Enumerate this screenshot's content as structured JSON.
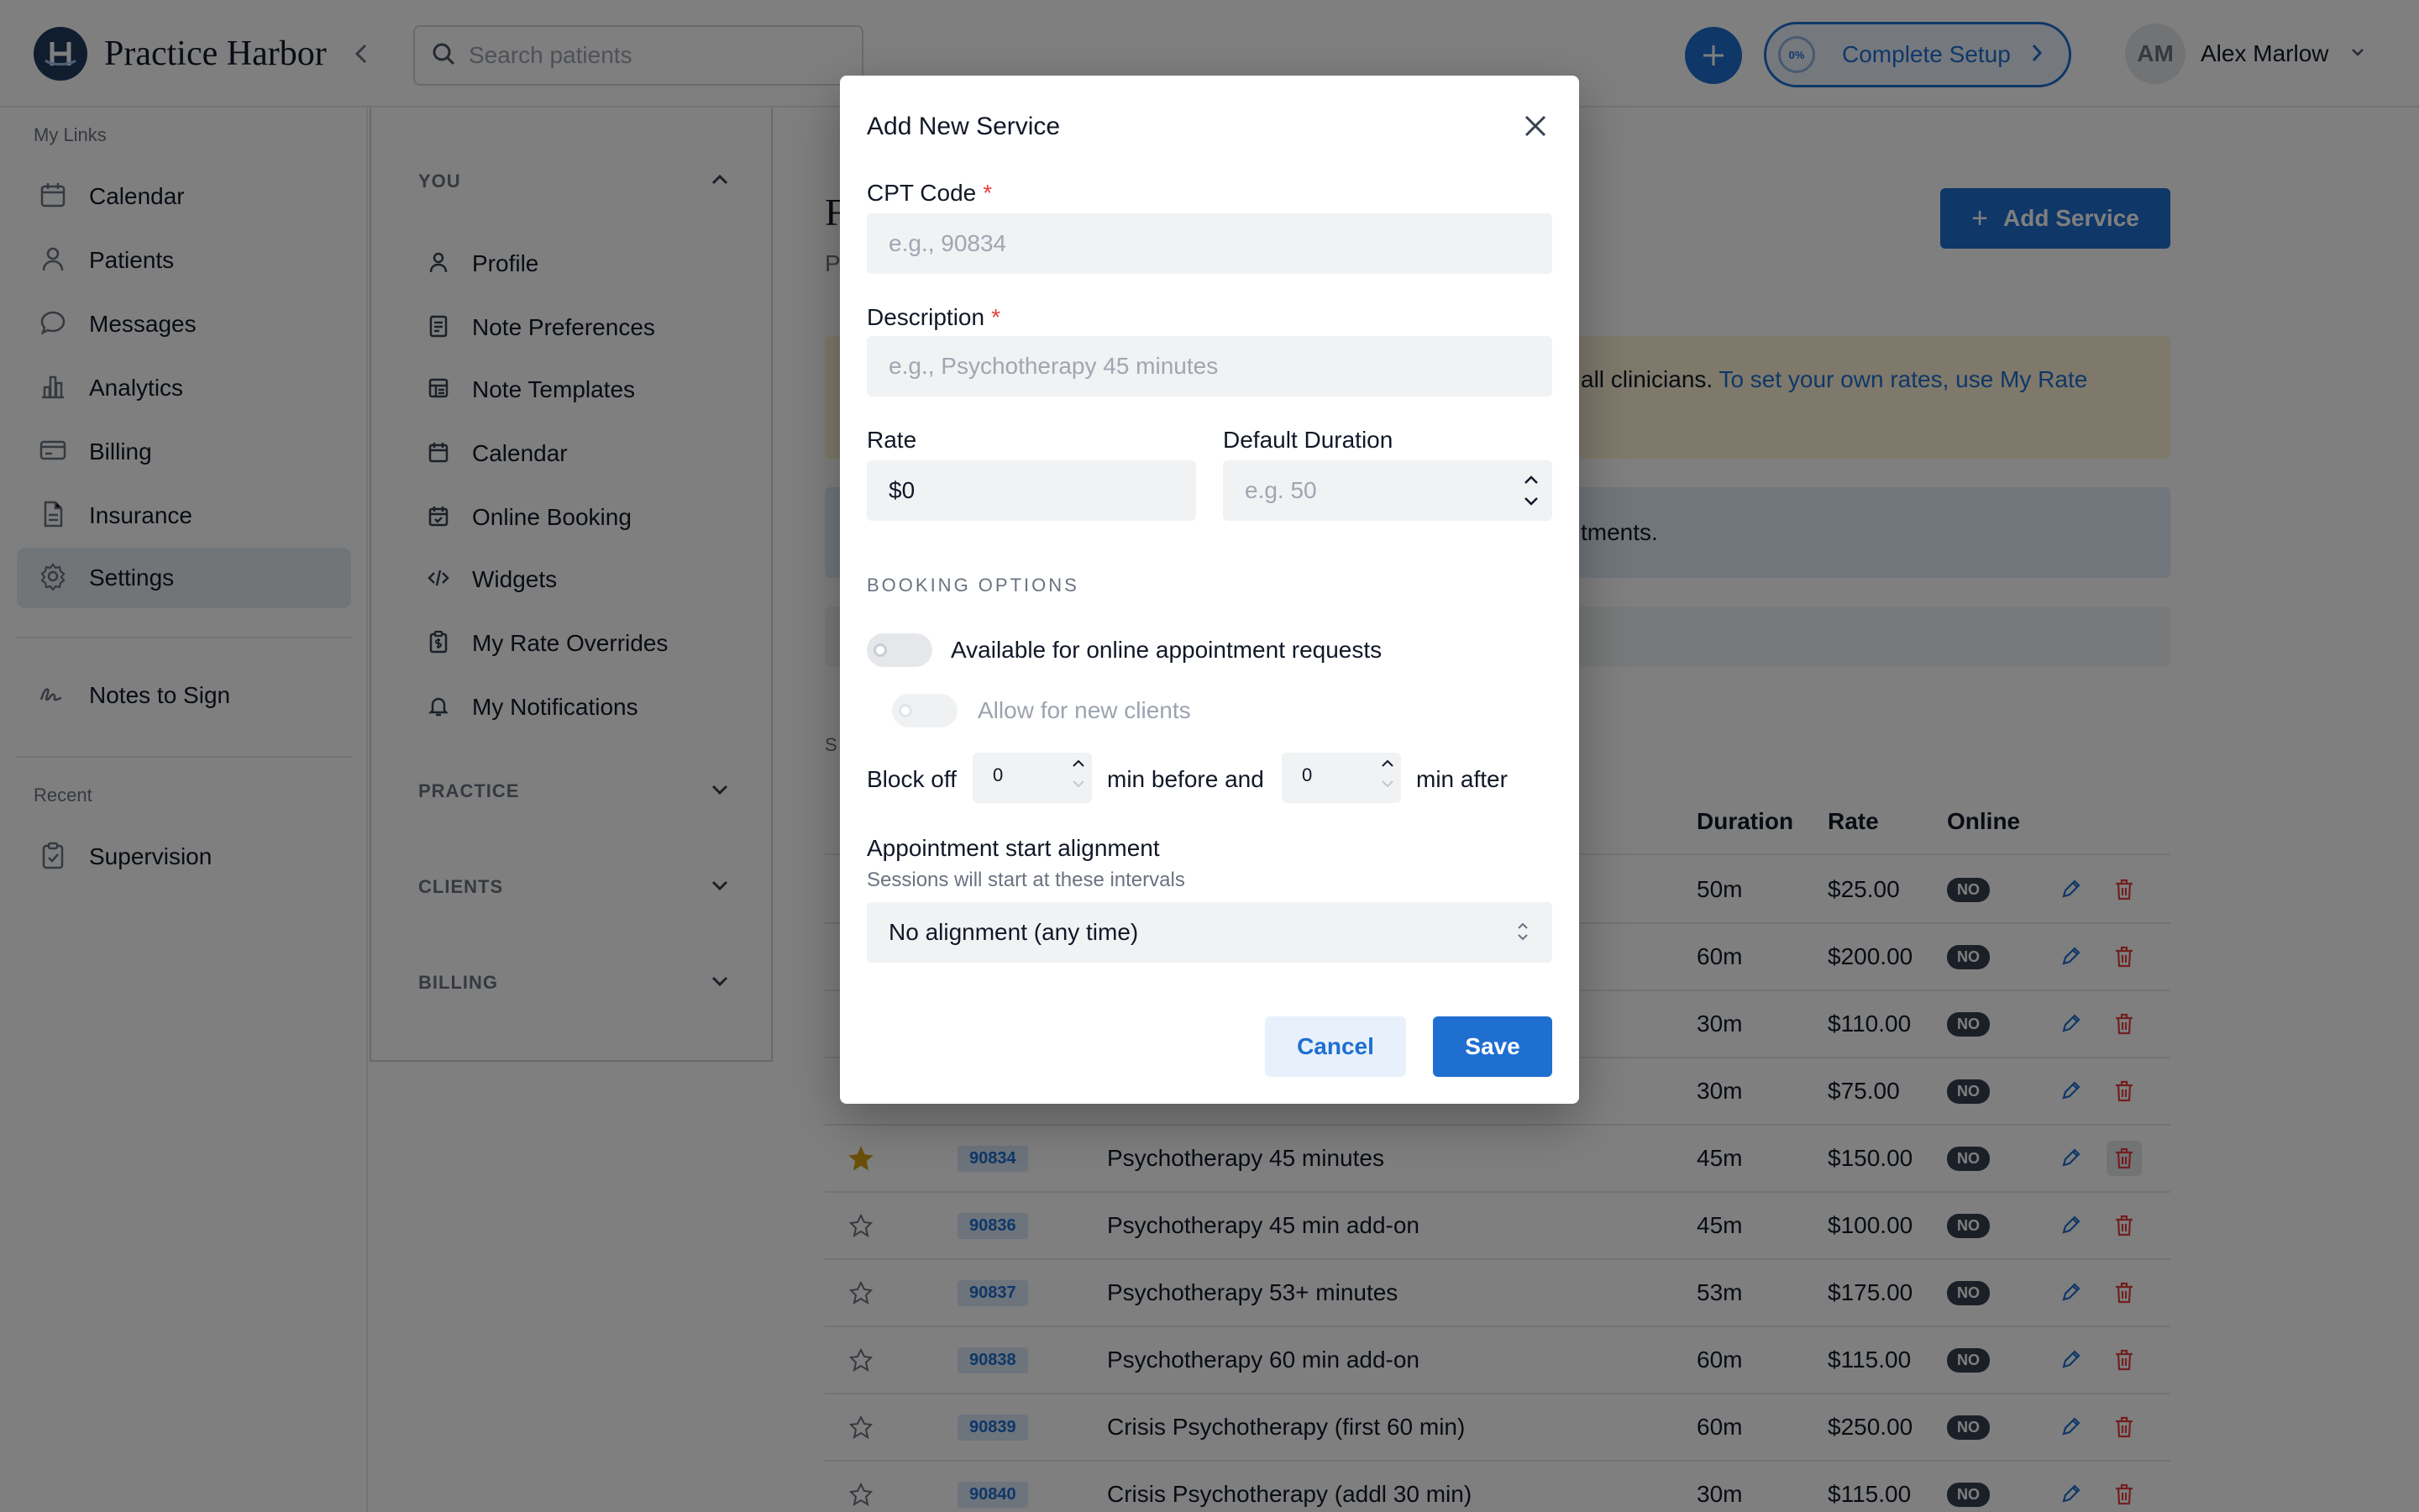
{
  "header": {
    "brand": "Practice Harbor",
    "search_placeholder": "Search patients",
    "setup_progress": "0%",
    "setup_label": "Complete Setup",
    "user_initials": "AM",
    "user_name": "Alex Marlow"
  },
  "sidebar": {
    "my_links_heading": "My Links",
    "items": [
      {
        "label": "Calendar",
        "icon": "calendar-icon"
      },
      {
        "label": "Patients",
        "icon": "person-icon"
      },
      {
        "label": "Messages",
        "icon": "chat-bubble-icon"
      },
      {
        "label": "Analytics",
        "icon": "bar-chart-icon"
      },
      {
        "label": "Billing",
        "icon": "credit-card-icon"
      },
      {
        "label": "Insurance",
        "icon": "document-icon"
      },
      {
        "label": "Settings",
        "icon": "gear-icon",
        "active": true
      }
    ],
    "notes_to_sign": "Notes to Sign",
    "recent_heading": "Recent",
    "recent_items": [
      {
        "label": "Supervision",
        "icon": "clipboard-icon"
      }
    ]
  },
  "settings_nav": {
    "sections": [
      {
        "label": "YOU",
        "expanded": true
      },
      {
        "label": "PRACTICE",
        "expanded": false
      },
      {
        "label": "CLIENTS",
        "expanded": false
      },
      {
        "label": "BILLING",
        "expanded": false
      }
    ],
    "you_items": [
      {
        "label": "Profile",
        "icon": "person-icon"
      },
      {
        "label": "Note Preferences",
        "icon": "document-icon"
      },
      {
        "label": "Note Templates",
        "icon": "template-icon"
      },
      {
        "label": "Calendar",
        "icon": "calendar-icon"
      },
      {
        "label": "Online Booking",
        "icon": "calendar-check-icon"
      },
      {
        "label": "Widgets",
        "icon": "code-icon"
      },
      {
        "label": "My Rate Overrides",
        "icon": "clipboard-dollar-icon"
      },
      {
        "label": "My Notifications",
        "icon": "bell-icon"
      }
    ]
  },
  "main": {
    "title_peek": "F",
    "subtitle_peek": "P",
    "add_service_label": "Add Service",
    "notice_yellow_text": "all clinicians. ",
    "notice_yellow_link": "To set your own rates, use My Rate",
    "notice_blue_text": "tments.",
    "section_peek": "S",
    "table_headers": {
      "duration": "Duration",
      "rate": "Rate",
      "online": "Online"
    },
    "rows": [
      {
        "starred": null,
        "code": "",
        "description": "",
        "duration": "50m",
        "rate": "$25.00",
        "online": "NO"
      },
      {
        "starred": null,
        "code": "",
        "description": "",
        "duration": "60m",
        "rate": "$200.00",
        "online": "NO"
      },
      {
        "starred": null,
        "code": "",
        "description": "",
        "duration": "30m",
        "rate": "$110.00",
        "online": "NO"
      },
      {
        "starred": null,
        "code": "",
        "description": "",
        "duration": "30m",
        "rate": "$75.00",
        "online": "NO"
      },
      {
        "starred": true,
        "code": "90834",
        "description": "Psychotherapy 45 minutes",
        "duration": "45m",
        "rate": "$150.00",
        "online": "NO"
      },
      {
        "starred": false,
        "code": "90836",
        "description": "Psychotherapy 45 min add-on",
        "duration": "45m",
        "rate": "$100.00",
        "online": "NO"
      },
      {
        "starred": false,
        "code": "90837",
        "description": "Psychotherapy 53+ minutes",
        "duration": "53m",
        "rate": "$175.00",
        "online": "NO"
      },
      {
        "starred": false,
        "code": "90838",
        "description": "Psychotherapy 60 min add-on",
        "duration": "60m",
        "rate": "$115.00",
        "online": "NO"
      },
      {
        "starred": false,
        "code": "90839",
        "description": "Crisis Psychotherapy (first 60 min)",
        "duration": "60m",
        "rate": "$250.00",
        "online": "NO"
      },
      {
        "starred": false,
        "code": "90840",
        "description": "Crisis Psychotherapy (addl 30 min)",
        "duration": "30m",
        "rate": "$115.00",
        "online": "NO"
      }
    ]
  },
  "modal": {
    "title": "Add New Service",
    "cpt_label": "CPT Code",
    "cpt_placeholder": "e.g., 90834",
    "desc_label": "Description",
    "desc_placeholder": "e.g., Psychotherapy 45 minutes",
    "required_mark": "*",
    "rate_label": "Rate",
    "rate_value": "$0",
    "duration_label": "Default Duration",
    "duration_placeholder": "e.g. 50",
    "booking_heading": "BOOKING OPTIONS",
    "online_toggle_label": "Available for online appointment requests",
    "new_clients_toggle_label": "Allow for new clients",
    "block_off_label": "Block off",
    "before_value": "0",
    "min_before_label": "min before and",
    "after_value": "0",
    "min_after_label": "min after",
    "alignment_label": "Appointment start alignment",
    "alignment_helper": "Sessions will start at these intervals",
    "alignment_value": "No alignment (any time)",
    "cancel_label": "Cancel",
    "save_label": "Save"
  },
  "colors": {
    "accent": "#1f6fd1",
    "star": "#d4a017",
    "trash": "#e53e3e",
    "overlay": "rgba(0,0,0,0.5)"
  }
}
